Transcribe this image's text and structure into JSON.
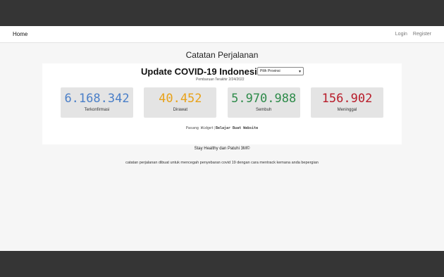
{
  "navbar": {
    "brand": "Home",
    "links": [
      "Login",
      "Register"
    ]
  },
  "page_title": "Catatan Perjalanan",
  "widget": {
    "title": "Update COVID-19 Indonesia",
    "last_update_label": "Pembaruan Terakhir",
    "last_update_date": "2/24/2022",
    "province_select": "Pilih Provinsi",
    "stats": [
      {
        "value": "6.168.342",
        "label": "Terkonfirmasi",
        "color": "#4a7fc8"
      },
      {
        "value": "40.452",
        "label": "Dirawat",
        "color": "#e8a21a"
      },
      {
        "value": "5.970.988",
        "label": "Sembuh",
        "color": "#2e8b4a"
      },
      {
        "value": "156.902",
        "label": "Meninggal",
        "color": "#b81c2a"
      }
    ],
    "footer_left": "Pasang Widget",
    "footer_separator": "|",
    "footer_right": "Belajar Buat Website"
  },
  "tagline": "Stay Healthy dan Patuhi 3M©",
  "description": "catatan perjalanan dibuat untuk mencegah penyebaran covid 19 dengan cara mentrack kemana anda bepergian"
}
